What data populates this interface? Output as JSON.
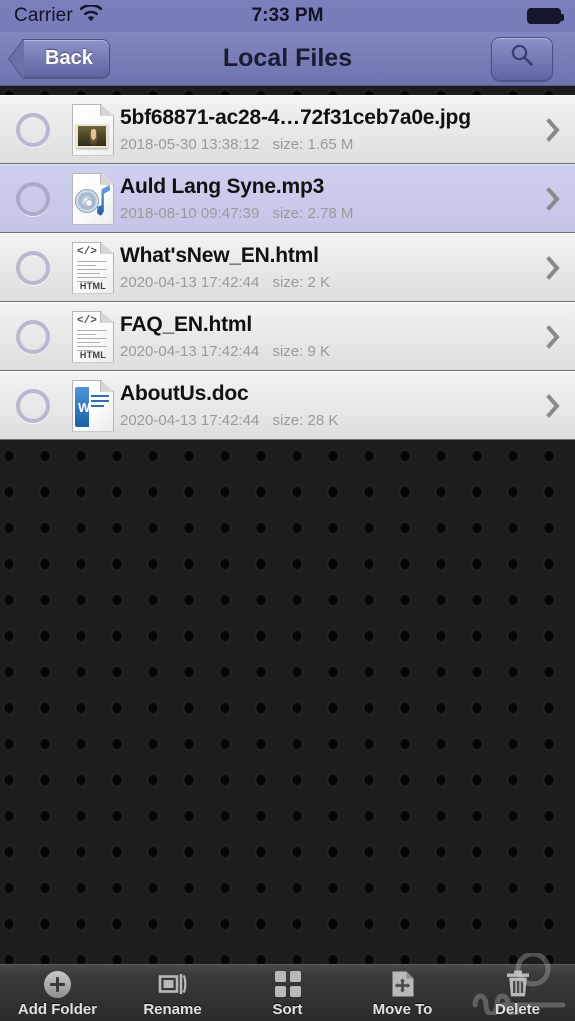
{
  "status_bar": {
    "carrier": "Carrier",
    "wifi_icon": "wifi-icon",
    "time": "7:33 PM",
    "battery_icon": "battery-full-icon"
  },
  "nav_bar": {
    "back_label": "Back",
    "title": "Local Files",
    "search_icon": "search-icon"
  },
  "files": [
    {
      "name": "5bf68871-ac28-4…72f31ceb7a0e.jpg",
      "date": "2018-05-30 13:38:12",
      "size": "size: 1.65 M",
      "kind": "image",
      "icon": "jpg-file-icon",
      "selected": false,
      "checked": false
    },
    {
      "name": "Auld Lang Syne.mp3",
      "date": "2018-08-10 09:47:39",
      "size": "size: 2.78 M",
      "kind": "audio",
      "icon": "mp3-file-icon",
      "selected": true,
      "checked": false
    },
    {
      "name": "What'sNew_EN.html",
      "date": "2020-04-13 17:42:44",
      "size": "size: 2 K",
      "kind": "html",
      "icon": "html-file-icon",
      "selected": false,
      "checked": false
    },
    {
      "name": "FAQ_EN.html",
      "date": "2020-04-13 17:42:44",
      "size": "size: 9 K",
      "kind": "html",
      "icon": "html-file-icon",
      "selected": false,
      "checked": false
    },
    {
      "name": "AboutUs.doc",
      "date": "2020-04-13 17:42:44",
      "size": "size: 28 K",
      "kind": "doc",
      "icon": "doc-file-icon",
      "selected": false,
      "checked": false
    }
  ],
  "html_icon_text": {
    "tag": "</>",
    "label": "HTML"
  },
  "toolbar": [
    {
      "label": "Add Folder",
      "icon": "plus-circle-icon"
    },
    {
      "label": "Rename",
      "icon": "rename-icon"
    },
    {
      "label": "Sort",
      "icon": "grid-squares-icon"
    },
    {
      "label": "Move To",
      "icon": "move-file-icon"
    },
    {
      "label": "Delete",
      "icon": "trash-icon"
    }
  ],
  "colors": {
    "navbar": "#7a7fba",
    "selected_row": "#c9c9ec",
    "row": "#e9e9e9",
    "toolbar": "#3a3a3a",
    "background": "#1a1a1a"
  }
}
